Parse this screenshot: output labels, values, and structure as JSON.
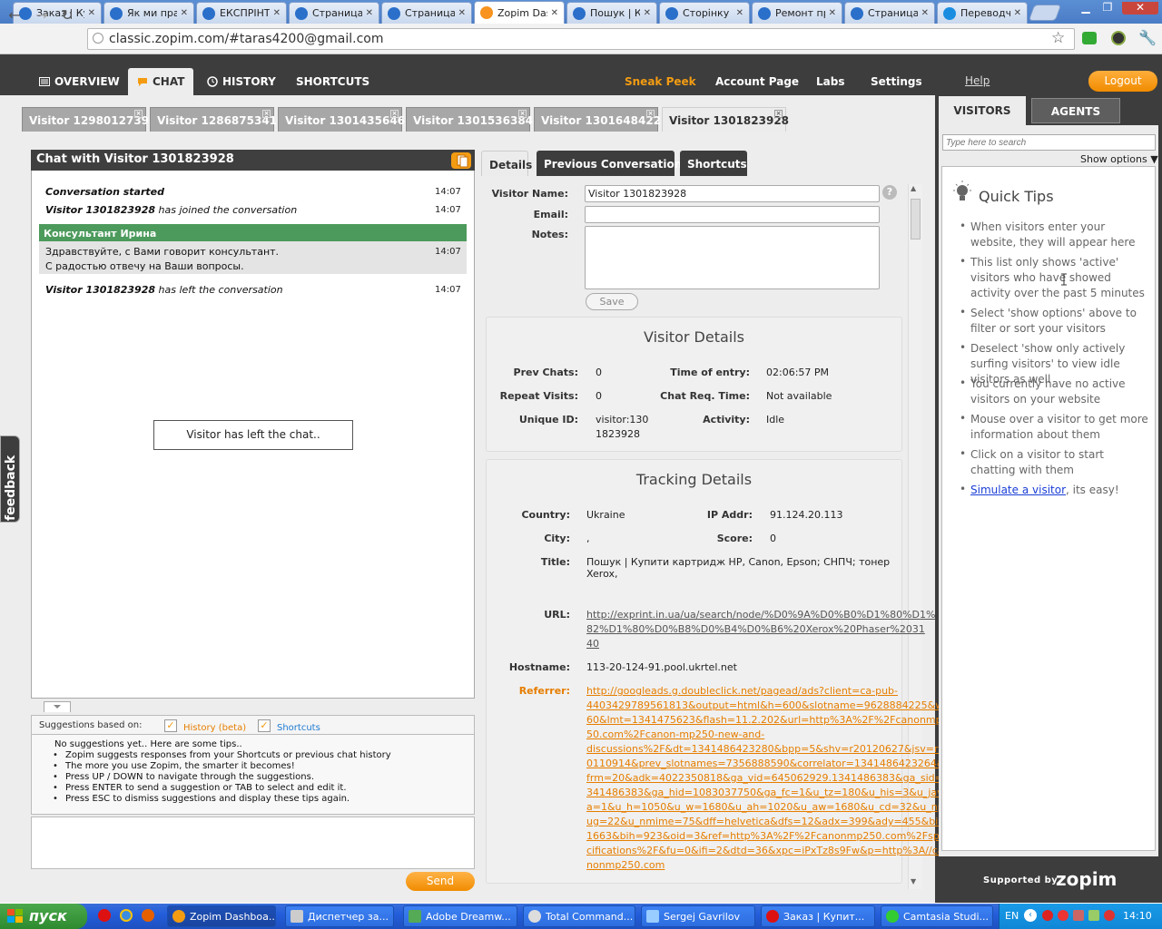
{
  "browser": {
    "tabs": [
      {
        "title": "Заказ | Ку",
        "active": false
      },
      {
        "title": "Як ми пра",
        "active": false
      },
      {
        "title": "ЕКСПРІНТ",
        "active": false
      },
      {
        "title": "Страница",
        "active": false
      },
      {
        "title": "Страница",
        "active": false
      },
      {
        "title": "Zopim Dasl",
        "active": true
      },
      {
        "title": "Пошук | Ку",
        "active": false
      },
      {
        "title": "Сторінку н",
        "active": false
      },
      {
        "title": "Ремонт пр",
        "active": false
      },
      {
        "title": "Страница",
        "active": false
      },
      {
        "title": "Переводчи",
        "active": false
      }
    ],
    "url": "classic.zopim.com/#taras4200@gmail.com"
  },
  "nav": {
    "overview": "OVERVIEW",
    "chat": "CHAT",
    "history": "HISTORY",
    "shortcuts": "SHORTCUTS",
    "sneak_peek": "Sneak Peek",
    "account_page": "Account Page",
    "labs": "Labs",
    "settings": "Settings"
  },
  "visitor_tabs": [
    "Visitor 1298012739",
    "Visitor 1286875341",
    "Visitor 1301435646",
    "Visitor 1301536384",
    "Visitor 1301648422",
    "Visitor 1301823928"
  ],
  "chat": {
    "title": "Chat with Visitor 1301823928",
    "started": "Conversation started",
    "started_time": "14:07",
    "joined_name": "Visitor 1301823928",
    "joined_text": "has joined the conversation",
    "joined_time": "14:07",
    "agent_name": "Консультант Ирина",
    "agent_line1": "Здравствуйте, с Вами говорит консультант.",
    "agent_line2": "С радостью отвечу на Ваши вопросы.",
    "agent_time": "14:07",
    "left_name": "Visitor 1301823928",
    "left_text": "has left the conversation",
    "left_time": "14:07",
    "left_notice": "Visitor has left the chat..",
    "send": "Send"
  },
  "suggestions": {
    "label": "Suggestions based on:",
    "history": "History (beta)",
    "shortcuts": "Shortcuts",
    "intro": "No suggestions yet.. Here are some tips..",
    "tips": [
      "Zopim suggests responses from your Shortcuts or previous chat history",
      "The more you use Zopim, the smarter it becomes!",
      "Press UP / DOWN to navigate through the suggestions.",
      "Press ENTER to send a suggestion or TAB to select and edit it.",
      "Press ESC to dismiss suggestions and display these tips again."
    ]
  },
  "feedback": "feedback",
  "details_tabs": {
    "details": "Details",
    "previous": "Previous Conversations",
    "shortcuts": "Shortcuts"
  },
  "form": {
    "name_label": "Visitor Name:",
    "name_value": "Visitor 1301823928",
    "email_label": "Email:",
    "notes_label": "Notes:",
    "save": "Save",
    "help": "?"
  },
  "visitor_details": {
    "title": "Visitor Details",
    "prev_chats_label": "Prev Chats:",
    "prev_chats": "0",
    "time_entry_label": "Time of entry:",
    "time_entry": "02:06:57 PM",
    "repeat_label": "Repeat Visits:",
    "repeat": "0",
    "chat_req_label": "Chat Req. Time:",
    "chat_req": "Not available",
    "unique_label": "Unique ID:",
    "unique_1": "visitor:130",
    "unique_2": "1823928",
    "activity_label": "Activity:",
    "activity": "Idle"
  },
  "tracking": {
    "title": "Tracking Details",
    "country_label": "Country:",
    "country": "Ukraine",
    "ip_label": "IP Addr:",
    "ip": "91.124.20.113",
    "city_label": "City:",
    "city": ",",
    "score_label": "Score:",
    "score": "0",
    "title_label": "Title:",
    "page_title": "Пошук | Купити картридж HP, Canon, Epson; СНПЧ; тонер Xerox,",
    "url_label": "URL:",
    "url_lines": [
      "http://exprint.in.ua/ua/search/node/%D0%9A%D0%B0%D1%80%D1%",
      "82%D1%80%D0%B8%D0%B4%D0%B6%20Xerox%20Phaser%2031",
      "40"
    ],
    "hostname_label": "Hostname:",
    "hostname": "113-20-124-91.pool.ukrtel.net",
    "referrer_label": "Referrer:",
    "referrer_lines": [
      "http://googleads.g.doubleclick.net/pagead/ads?client=ca-pub-",
      "4403429789561813&output=html&h=600&slotname=9628884225&w=1",
      "60&lmt=1341475623&flash=11.2.202&url=http%3A%2F%2Fcanonmp2",
      "50.com%2Fcanon-mp250-new-and-",
      "discussions%2F&dt=1341486423280&bpp=5&shv=r20120627&jsv=r2",
      "0110914&prev_slotnames=7356888590&correlator=1341486423264&",
      "frm=20&adk=4022350818&ga_vid=645062929.1341486383&ga_sid=1",
      "341486383&ga_hid=1083037750&ga_fc=1&u_tz=180&u_his=3&u_jav",
      "a=1&u_h=1050&u_w=1680&u_ah=1020&u_aw=1680&u_cd=32&u_npl",
      "ug=22&u_nmime=75&dff=helvetica&dfs=12&adx=399&ady=455&biw=",
      "1663&bih=923&oid=3&ref=http%3A%2F%2Fcanonmp250.com%2Fspe",
      "cifications%2F&fu=0&ifi=2&dtd=36&xpc=iPxTz8s9Fw&p=http%3A//ca",
      "nonmp250.com"
    ]
  },
  "sidebar": {
    "help": "Help",
    "logout": "Logout",
    "visitors_tab": "VISITORS",
    "agents_tab": "AGENTS",
    "search_placeholder": "Type here to search",
    "show_options": "Show options ▼",
    "quick_tips_title": "Quick Tips",
    "tips": [
      "When visitors enter your website, they will appear here",
      "This list only shows 'active' visitors who have showed activity over the past 5 minutes",
      "Select 'show options' above to filter or sort your visitors",
      "Deselect 'show only actively surfing visitors' to view idle visitors as well",
      "You currently have no active visitors on your website",
      "Mouse over a visitor to get more information about them",
      "Click on a visitor to start chatting with them"
    ],
    "simulate_link": "Simulate a visitor",
    "simulate_rest": ", its easy!",
    "supported_by": "Supported by",
    "brand": "zopim"
  },
  "taskbar": {
    "start": "пуск",
    "tasks": [
      "Zopim Dashboa...",
      "Диспетчер за...",
      "Adobe Dreamw...",
      "Total Command...",
      "Sergej Gavrilov",
      "Заказ | Купит...",
      "Camtasia Studi..."
    ],
    "lang": "EN",
    "clock": "14:10"
  },
  "colors": {
    "accent": "#f39c12",
    "dark": "#3d3d3d",
    "agent_green": "#4c9a5c"
  }
}
